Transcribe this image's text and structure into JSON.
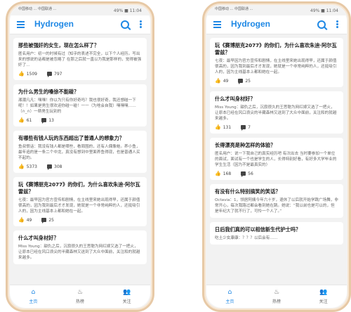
{
  "app": {
    "title": "Hydrogen"
  },
  "status": {
    "carrier": "中国移动 ...\n中国联通 ...",
    "right": "49% ■ 11:04"
  },
  "nav": {
    "home": "主页",
    "hot": "热榜",
    "follow": "关注"
  },
  "left_feed": [
    {
      "title": "那些被强奸的女生，现在怎么样了？",
      "excerpt": "匿名用户：初一的时候有过（知乎的表述不完全，以下个人经历。写出来的想说的话都是被忽略了 在那之后就一直以为我是那样的，觉得被强奸了...",
      "likes": "1509",
      "comments": "797"
    },
    {
      "title": "为什么男生的嗓徐不能碰？",
      "excerpt": "湘潮凡凡：嘿嘿！你以为只有你好奇吗？我也很好奇，我还想碰一下呢！！如果是男生很欢迎你碰一碰！一一（为啥会自我）嘿嘿嘿……（∩_∩）一萌男生玩别的",
      "likes": "61",
      "comments": "13"
    },
    {
      "title": "有哪些有钱人玩的东西超出了普通人的想象力？",
      "excerpt": "鱼叔恨话：我没有钱人都是哪些，看周围的，还有人偶像蛙。养小鱼，最年追的是一条二个中龙，真没有想到中里面养鱼得现，也是普通人买不起的。",
      "likes": "5373",
      "comments": "308"
    },
    {
      "title": "玩《赛博朋克2077》的你们，为什么喜欢朱迪·阿尔瓦雷兹？",
      "excerpt": "七夜：最早因为官方宣传和剧情，在主线里来她出现得早，还属于颜值很高的，因为我到最后才才发现，她就是一个非常纯粹的人，还挺吸引人的，因为主线基本上都和她在一起。",
      "likes": "49",
      "comments": "25"
    },
    {
      "title": "什么才叫身材好？",
      "excerpt": "Miss Young：甜仇之后，沉寂很久的王思聪为网红嫁又选了一把火，让原本已经在风口浪尖的半藏森林又送到了大众中面前，关注和的就越来越多。",
      "likes": "",
      "comments": ""
    }
  ],
  "right_feed": [
    {
      "title": "玩《赛博朋克2077》的你们，为什么喜欢朱迪·阿尔瓦雷兹？",
      "excerpt": "七夜：最早因为官方宣传和剧情，在主线里来她出现得早，还属于颜值很高的，因为我到最后才才发现，她就是一个非常纯粹的人，还挺吸引人的，因为主线基本上都和她在一起。",
      "likes": "49",
      "comments": "25"
    },
    {
      "title": "什么才叫身材好？",
      "excerpt": "Miss Young：甜仇之后，沉寂很久的王思聪为网红嫁又选了一把火，让原本已经在风口浪尖的半藏森林又送到了大众中面前，关注和的就越来越多。",
      "likes": "131",
      "comments": "7"
    },
    {
      "title": "长得漂亮是种怎样的体验？",
      "excerpt": "匿名用户：说一下我自己的真实经历吧 有次出去 当时要参加一个单位的面试，面试有一个也是学生的人，长得特别好看，有好多大学毕业的学生生活（因为不是最真实的）",
      "likes": "168",
      "comments": "56"
    },
    {
      "title": "有没有什么特别搞笑的笑话？",
      "excerpt": "Octavia：1，领居阿姨今年六十岁，退休了以后就开始学跳广场舞，非常开心，每次我路过都会看到她在跳。她说：“我以前也是可以的，但是年纪大了就不行了，可怜一个人了。”",
      "likes": "",
      "comments": ""
    },
    {
      "title": "日后我们真的可以相信新生代护士吗？",
      "excerpt": "吃土少女康康：？？？以后会有……",
      "likes": "",
      "comments": ""
    }
  ],
  "icons": {
    "menu": "menu-icon",
    "search": "search-icon",
    "more": "more-icon",
    "like": "thumb-up-icon",
    "comment": "comment-icon",
    "home": "home-icon",
    "hot": "flame-icon",
    "follow": "people-icon"
  },
  "colors": {
    "accent": "#1e88e5",
    "frame": "#e7c9a6"
  }
}
